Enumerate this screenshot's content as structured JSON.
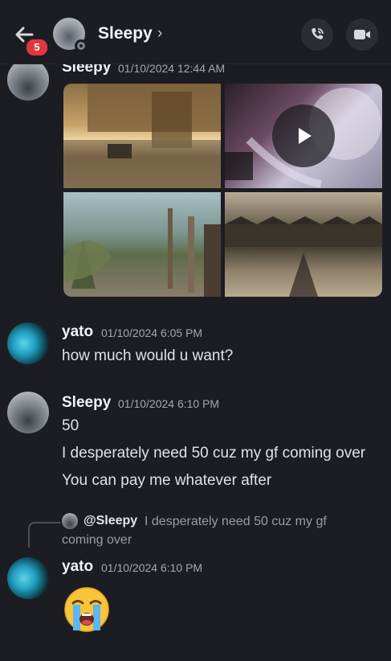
{
  "header": {
    "back_badge": "5",
    "name": "Sleepy",
    "chevron": "›",
    "icons": [
      "back-arrow-icon",
      "phone-call-icon",
      "video-camera-icon"
    ]
  },
  "messages": [
    {
      "author": "Sleepy",
      "timestamp": "01/10/2024 12:44 AM",
      "attachments": [
        "image-street",
        "video-thumbnail",
        "image-forest",
        "image-village"
      ]
    },
    {
      "author": "yato",
      "timestamp": "01/10/2024 6:05 PM",
      "lines": [
        "how much would u want?"
      ]
    },
    {
      "author": "Sleepy",
      "timestamp": "01/10/2024 6:10 PM",
      "lines": [
        "50",
        "I desperately need 50 cuz my gf coming over",
        "You can pay me whatever after"
      ]
    },
    {
      "reply_to": {
        "mention": "@Sleepy",
        "text_line1": "I desperately need 50 cuz my gf",
        "text_line2": "coming over"
      },
      "author": "yato",
      "timestamp": "01/10/2024 6:10 PM",
      "emoji": "loudly-crying-face"
    }
  ],
  "colors": {
    "background": "#1c1d23",
    "badge": "#e0373e",
    "text": "#dfe1e5",
    "muted": "#a4a7ae"
  }
}
